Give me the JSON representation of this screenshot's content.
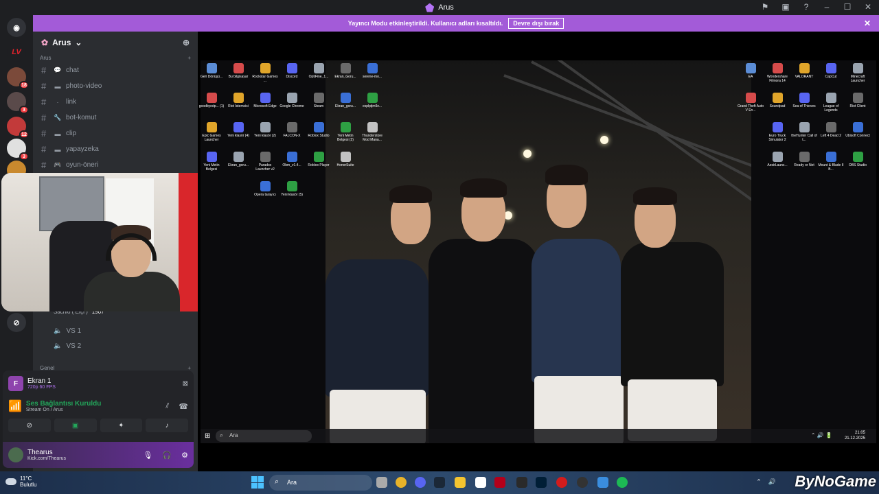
{
  "window": {
    "title": "Arus"
  },
  "banner": {
    "message": "Yayıncı Modu etkinleştirildi. Kullanıcı adları kısaltıldı.",
    "disable_label": "Devre dışı bırak"
  },
  "rail": {
    "badges": [
      "18",
      "3",
      "12",
      "3",
      "3"
    ],
    "logo_text": "LV"
  },
  "server": {
    "name": "Arus",
    "category": "Arus",
    "channels": [
      {
        "icon": "💬",
        "name": "chat"
      },
      {
        "icon": "▬",
        "name": "photo-video"
      },
      {
        "icon": "·",
        "name": "link"
      },
      {
        "icon": "🔧",
        "name": "bot-komut"
      },
      {
        "icon": "▬",
        "name": "clip"
      },
      {
        "icon": "▬",
        "name": "yapayzeka"
      },
      {
        "icon": "🎮",
        "name": "oyun-öneri"
      }
    ],
    "voice_user": {
      "name": "Sachio ( Etçi )",
      "tag": "1907"
    },
    "voice_channels": [
      "VS 1",
      "VS 2"
    ],
    "category2": "Genel"
  },
  "panel": {
    "stream_title": "Ekran 1",
    "stream_quality": "720p 60 FPS",
    "stream_initial": "F",
    "conn_status": "Ses Bağlantısı Kuruldu",
    "conn_sub": "Stream On / Arus",
    "user_name": "Thearus",
    "user_status": "Kick.com/Thearus"
  },
  "desktop": {
    "left_icons": [
      [
        "Geri Dönüşü...",
        "Bu bilgisayar",
        "Rockstar Games ...",
        "Discord",
        "OptiFine_1...",
        "Ekran_Goru...",
        "serene-mo..."
      ],
      [
        "goodbyedp... (1)",
        "Riot İstemcisi",
        "Microsoft Edge",
        "Google Chrome",
        "Steam",
        "Ekran_goru...",
        "esplptjm9z..."
      ],
      [
        "Epic Games Launcher",
        "Yeni klasör (4)",
        "Yeni klasör (2)",
        "FALCON-X",
        "Roblox Studio",
        "Yeni Metin Belgesi (2)",
        "Thunderstore Mod Mana..."
      ],
      [
        "Yeni Metin Belgesi",
        "Ekran_goru...",
        "Paradox Launcher v2",
        "Obm_v1.4...",
        "Roblox Player",
        "HonorSuite"
      ],
      [
        "",
        "",
        "Opera tarayıcı",
        "Yeni klasör (5)"
      ]
    ],
    "right_icons": [
      [
        "EA",
        "Wondershare Filmora 14",
        "VALORANT",
        "CapCut",
        "Minecraft Launcher"
      ],
      [
        "Grand Theft Auto V En...",
        "Soundpad",
        "Sea of Thieves",
        "League of Legends",
        "Riot Client"
      ],
      [
        "",
        "Euro Truck Simulator 2",
        "theHunter Call of t...",
        "Left 4 Dead 2",
        "Ubisoft Connect"
      ],
      [
        "",
        "AesirLaunc...",
        "Ready or Not",
        "Mount & Blade II B...",
        "OBS Studio"
      ]
    ],
    "search": "Ara",
    "time": "21:05",
    "date": "21.12.2025"
  },
  "taskbar": {
    "temp": "11°C",
    "weather": "Bulutlu",
    "search": "Ara",
    "watermark": "ByNoGame"
  }
}
